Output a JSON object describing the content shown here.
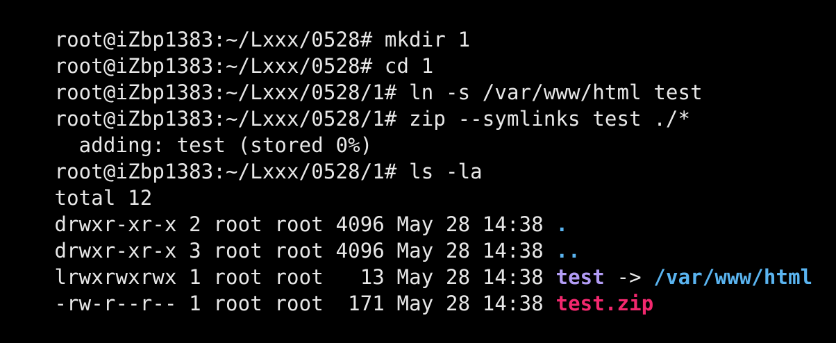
{
  "terminal": {
    "lines": [
      {
        "segments": [
          {
            "text": "root@iZbp1383:~/Lxxx/0528# mkdir 1",
            "style": "plain"
          }
        ]
      },
      {
        "segments": [
          {
            "text": "root@iZbp1383:~/Lxxx/0528# cd 1",
            "style": "plain"
          }
        ]
      },
      {
        "segments": [
          {
            "text": "root@iZbp1383:~/Lxxx/0528/1# ln -s /var/www/html test",
            "style": "plain"
          }
        ]
      },
      {
        "segments": [
          {
            "text": "root@iZbp1383:~/Lxxx/0528/1# zip --symlinks test ./*",
            "style": "plain"
          }
        ]
      },
      {
        "segments": [
          {
            "text": "  adding: test (stored 0%)",
            "style": "plain"
          }
        ]
      },
      {
        "segments": [
          {
            "text": "root@iZbp1383:~/Lxxx/0528/1# ls -la",
            "style": "plain"
          }
        ]
      },
      {
        "segments": [
          {
            "text": "total 12",
            "style": "plain"
          }
        ]
      },
      {
        "segments": [
          {
            "text": "drwxr-xr-x 2 root root 4096 May 28 14:38 ",
            "style": "plain"
          },
          {
            "text": ".",
            "style": "dir"
          }
        ]
      },
      {
        "segments": [
          {
            "text": "drwxr-xr-x 3 root root 4096 May 28 14:38 ",
            "style": "plain"
          },
          {
            "text": "..",
            "style": "dir"
          }
        ]
      },
      {
        "segments": [
          {
            "text": "lrwxrwxrwx 1 root root   13 May 28 14:38 ",
            "style": "plain"
          },
          {
            "text": "test",
            "style": "link"
          },
          {
            "text": " -> ",
            "style": "plain"
          },
          {
            "text": "/var/www/html",
            "style": "dir"
          }
        ]
      },
      {
        "segments": [
          {
            "text": "-rw-r--r-- 1 root root  171 May 28 14:38 ",
            "style": "plain"
          },
          {
            "text": "test.zip",
            "style": "zip"
          }
        ]
      }
    ]
  },
  "colors": {
    "background": "#000000",
    "text": "#e8e8e8",
    "directory": "#5ab4f0",
    "symlink": "#b29cf5",
    "archive": "#f2286e"
  }
}
